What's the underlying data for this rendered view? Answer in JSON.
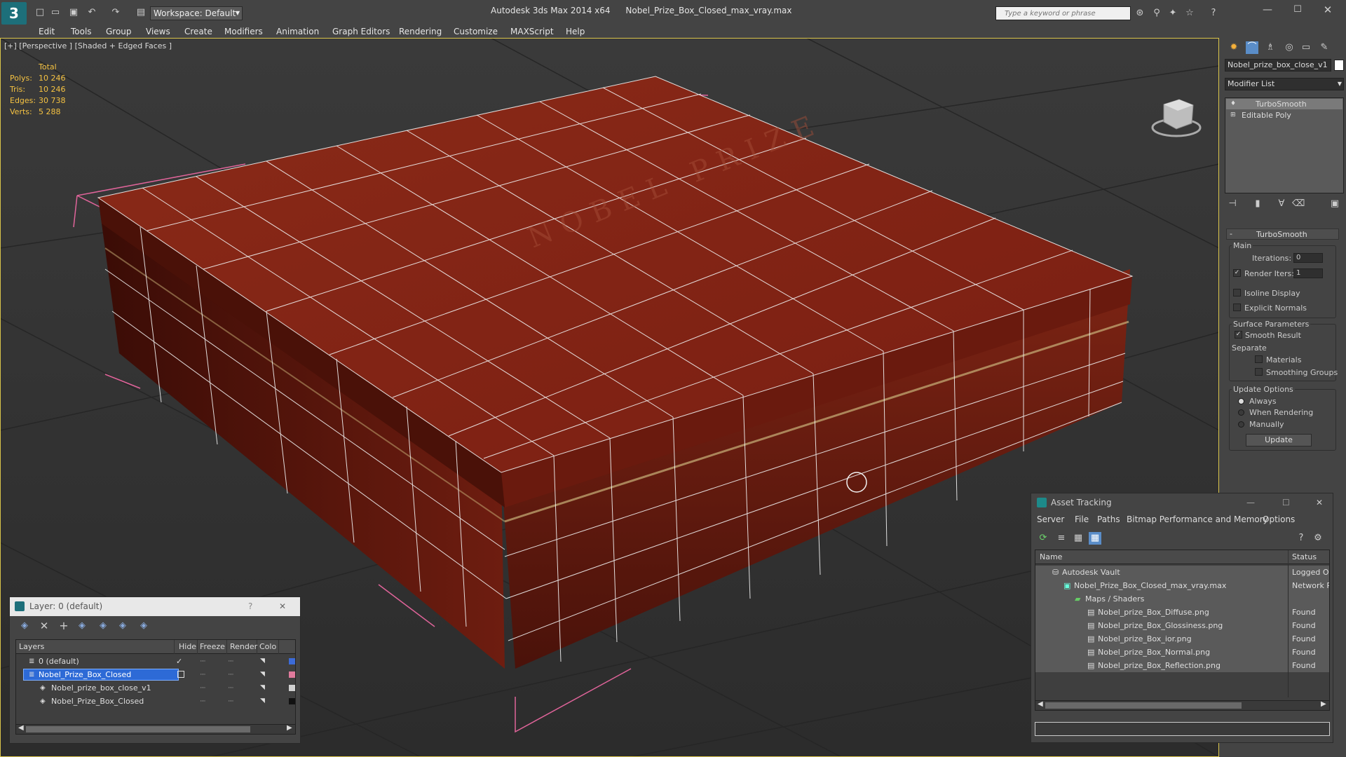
{
  "app": {
    "title": "Autodesk 3ds Max  2014 x64",
    "filename": "Nobel_Prize_Box_Closed_max_vray.max",
    "workspace": "Workspace: Default",
    "search_placeholder": "Type a keyword or phrase"
  },
  "menu": [
    "Edit",
    "Tools",
    "Group",
    "Views",
    "Create",
    "Modifiers",
    "Animation",
    "Graph Editors",
    "Rendering",
    "Customize",
    "MAXScript",
    "Help"
  ],
  "viewport": {
    "label": "[+] [Perspective ] [Shaded + Edged Faces ]",
    "stats_header": "Total",
    "stats": [
      {
        "label": "Polys:",
        "value": "10 246"
      },
      {
        "label": "Tris:",
        "value": "10 246"
      },
      {
        "label": "Edges:",
        "value": "30 738"
      },
      {
        "label": "Verts:",
        "value": "5 288"
      }
    ],
    "model_text": "NOBEL PRIZE",
    "colors": {
      "box": "#7a1e12",
      "wire": "#f2f2f2",
      "bbox": "#e0649a",
      "stats": "#f5c242"
    }
  },
  "command_panel": {
    "object_name": "Nobel_prize_box_close_v1",
    "modifier_list": "Modifier List",
    "stack": [
      "TurboSmooth",
      "Editable Poly"
    ],
    "rollout_title": "TurboSmooth",
    "main_group": "Main",
    "iterations_label": "Iterations:",
    "iterations_value": "0",
    "render_iters_label": "Render Iters:",
    "render_iters_value": "1",
    "isoline": "Isoline Display",
    "explicit_normals": "Explicit Normals",
    "surface_group": "Surface Parameters",
    "smooth_result": "Smooth Result",
    "separate": "Separate",
    "materials": "Materials",
    "smoothing_groups": "Smoothing Groups",
    "update_group": "Update Options",
    "always": "Always",
    "when_rendering": "When Rendering",
    "manually": "Manually",
    "update_button": "Update"
  },
  "asset_tracking": {
    "title": "Asset Tracking",
    "menu": [
      "Server",
      "File",
      "Paths",
      "Bitmap Performance and Memory",
      "Options"
    ],
    "col_name": "Name",
    "col_status": "Status",
    "rows": [
      {
        "name": "Autodesk Vault",
        "status": "Logged Out"
      },
      {
        "name": "Nobel_Prize_Box_Closed_max_vray.max",
        "status": "Network Pat"
      },
      {
        "name": "Maps / Shaders",
        "status": ""
      },
      {
        "name": "Nobel_prize_Box_Diffuse.png",
        "status": "Found"
      },
      {
        "name": "Nobel_prize_Box_Glossiness.png",
        "status": "Found"
      },
      {
        "name": "Nobel_prize_Box_ior.png",
        "status": "Found"
      },
      {
        "name": "Nobel_prize_Box_Normal.png",
        "status": "Found"
      },
      {
        "name": "Nobel_prize_Box_Reflection.png",
        "status": "Found"
      }
    ]
  },
  "layer_window": {
    "title": "Layer: 0 (default)",
    "help": "?",
    "col_layers": "Layers",
    "col_hide": "Hide",
    "col_freeze": "Freeze",
    "col_render": "Render",
    "col_color": "Colo",
    "rows": [
      {
        "name": "0 (default)",
        "color": "#3c6bd8"
      },
      {
        "name": "Nobel_Prize_Box_Closed",
        "color": "#e07a9c"
      },
      {
        "name": "Nobel_prize_box_close_v1",
        "color": "#d0d0d0"
      },
      {
        "name": "Nobel_Prize_Box_Closed",
        "color": "#111111"
      }
    ]
  }
}
